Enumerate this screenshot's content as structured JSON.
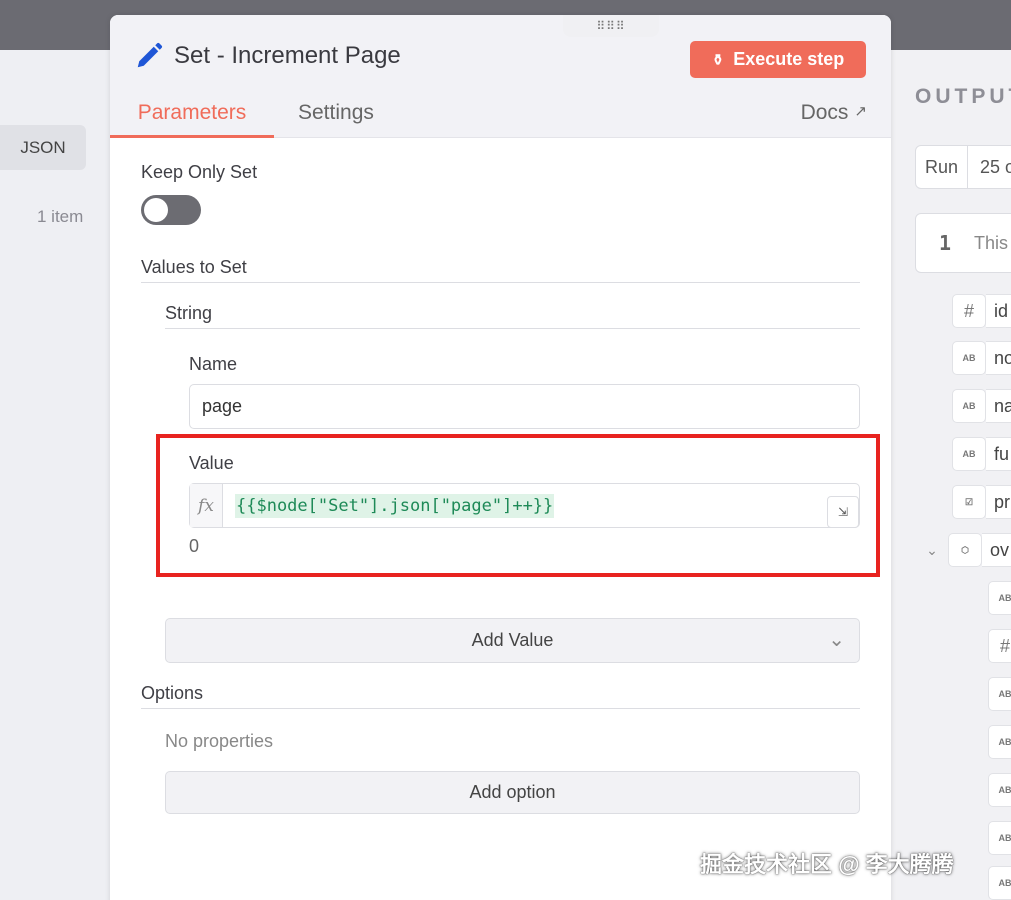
{
  "input_panel": {
    "json_tab": "JSON",
    "item_count": "1 item"
  },
  "modal": {
    "title": "Set - Increment Page",
    "execute_button": "Execute step",
    "tabs": [
      {
        "label": "Parameters",
        "active": true
      },
      {
        "label": "Settings",
        "active": false
      }
    ],
    "docs_label": "Docs"
  },
  "params": {
    "keep_only_set_label": "Keep Only Set",
    "keep_only_set_enabled": false,
    "values_to_set_label": "Values to Set",
    "string_label": "String",
    "name_label": "Name",
    "name_value": "page",
    "value_label": "Value",
    "value_fx": "fx",
    "value_expression": "{{$node[\"Set\"].json[\"page\"]++}}",
    "value_result": "0",
    "add_value_button": "Add Value",
    "options_label": "Options",
    "no_properties": "No properties",
    "add_option_button": "Add option"
  },
  "output_panel": {
    "title": "OUTPUT",
    "run_label": "Run",
    "run_value": "25 o",
    "info_number": "1",
    "info_text": "This",
    "fields": [
      {
        "type": "#",
        "name": "id"
      },
      {
        "type": "AB",
        "name": "no"
      },
      {
        "type": "AB",
        "name": "na"
      },
      {
        "type": "AB",
        "name": "fu"
      },
      {
        "type": "☑",
        "name": "pr"
      },
      {
        "type": "⬡",
        "name": "ov"
      }
    ],
    "nested_types": [
      "AB",
      "#",
      "AB",
      "AB",
      "AB",
      "AB",
      "AB"
    ]
  },
  "watermark": "掘金技术社区 @ 李大腾腾",
  "colors": {
    "accent": "#f06c5a",
    "highlight_box": "#e8231f",
    "expression_text": "#1e8a57",
    "expression_bg": "#dff3e7",
    "toggle_off": "#6c6c72"
  }
}
